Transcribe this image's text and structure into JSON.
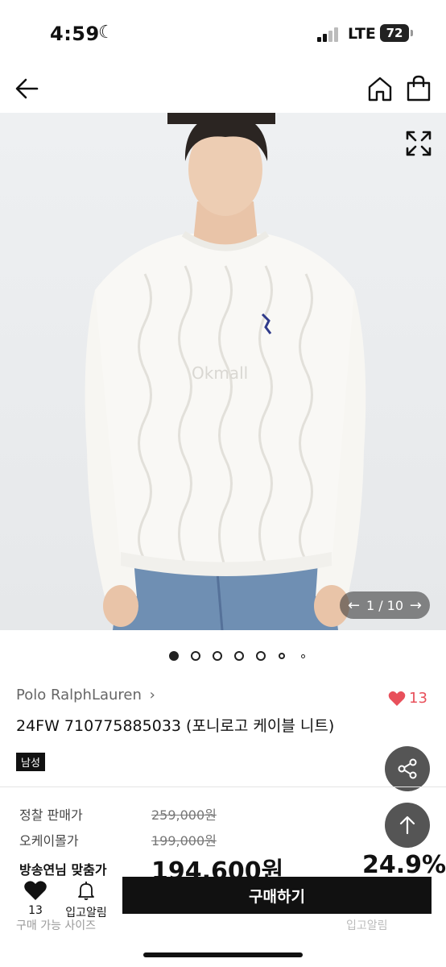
{
  "status": {
    "time": "4:59",
    "network": "LTE",
    "battery": "72"
  },
  "gallery": {
    "counter": "1 / 10",
    "watermark": "Okmall",
    "page_count": 7,
    "active_index": 0
  },
  "product": {
    "brand": "Polo RalphLauren",
    "brand_chevron": "›",
    "likes": "13",
    "title": "24FW  710775885033 (포니로고 케이블 니트)",
    "gender_tag": "남성"
  },
  "prices": {
    "retail_label": "정찰 판매가",
    "retail_value": "259,000원",
    "okmall_label": "오케이몰가",
    "okmall_value": "199,000원",
    "member_label": "방송연님 맞춤가",
    "member_value": "194,600원",
    "discount": "24.9%"
  },
  "bottom": {
    "wish_count": "13",
    "restock_label": "입고알림",
    "buy_label": "구매하기",
    "size_label": "구매 가능 사이즈",
    "restock_small": "입고알림"
  },
  "colors": {
    "accent": "#e8505b",
    "dark": "#111111",
    "fab": "#555555"
  }
}
